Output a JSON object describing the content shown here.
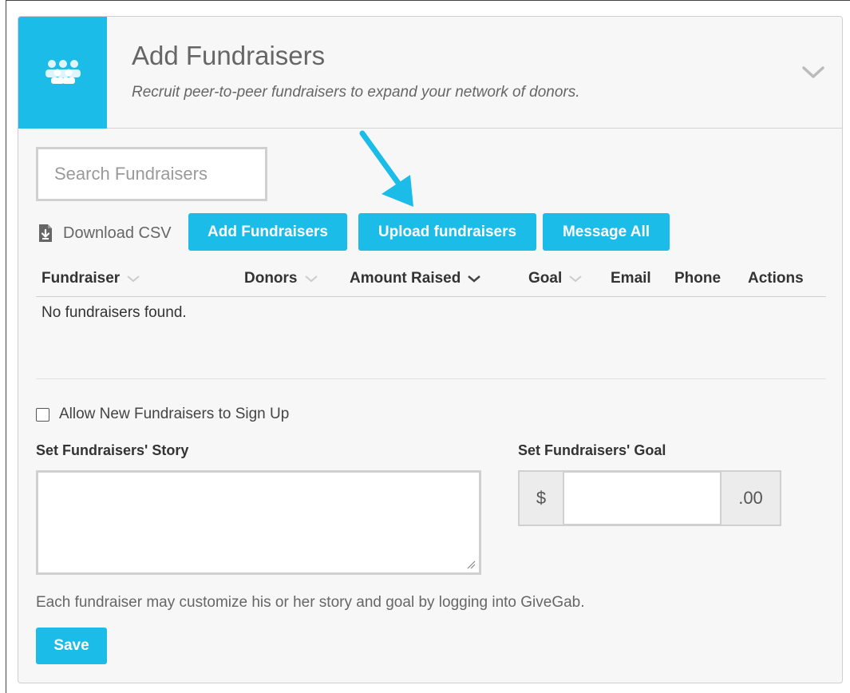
{
  "header": {
    "title": "Add Fundraisers",
    "subtitle": "Recruit peer-to-peer fundraisers to expand your network of donors.",
    "icon": "group-icon",
    "accent_color": "#1bbde8"
  },
  "search": {
    "placeholder": "Search Fundraisers",
    "value": ""
  },
  "toolbar": {
    "download_label": "Download CSV",
    "add_label": "Add Fundraisers",
    "upload_label": "Upload fundraisers",
    "message_label": "Message All"
  },
  "table": {
    "columns": [
      "Fundraiser",
      "Donors",
      "Amount Raised",
      "Goal",
      "Email",
      "Phone",
      "Actions"
    ],
    "empty_text": "No fundraisers found."
  },
  "settings": {
    "allow_signup_label": "Allow New Fundraisers to Sign Up",
    "allow_signup_checked": false,
    "story_label": "Set Fundraisers' Story",
    "story_value": "",
    "goal_label": "Set Fundraisers' Goal",
    "goal_prefix": "$",
    "goal_suffix": ".00",
    "goal_value": "",
    "help_text": "Each fundraiser may customize his or her story and goal by logging into GiveGab.",
    "save_label": "Save"
  }
}
